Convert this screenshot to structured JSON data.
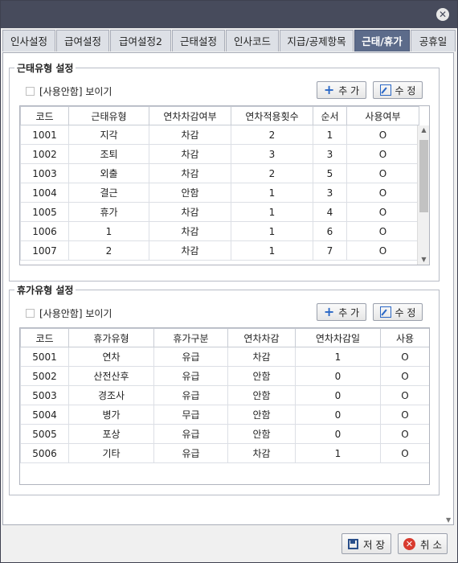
{
  "window": {
    "close_glyph": "✕"
  },
  "tabs": [
    {
      "label": "인사설정"
    },
    {
      "label": "급여설정"
    },
    {
      "label": "급여설정2"
    },
    {
      "label": "근태설정"
    },
    {
      "label": "인사코드"
    },
    {
      "label": "지급/공제항목"
    },
    {
      "label": "근태/휴가"
    },
    {
      "label": "공휴일"
    }
  ],
  "active_tab": "근태/휴가",
  "attendance": {
    "title": "근태유형 설정",
    "show_unused_label": "[사용안함] 보이기",
    "add_label": "추 가",
    "edit_label": "수 정",
    "columns": [
      "코드",
      "근태유형",
      "연차차감여부",
      "연차적용횟수",
      "순서",
      "사용여부"
    ],
    "rows": [
      [
        "1001",
        "지각",
        "차감",
        "2",
        "1",
        "O"
      ],
      [
        "1002",
        "조퇴",
        "차감",
        "3",
        "3",
        "O"
      ],
      [
        "1003",
        "외출",
        "차감",
        "2",
        "5",
        "O"
      ],
      [
        "1004",
        "결근",
        "안함",
        "1",
        "3",
        "O"
      ],
      [
        "1005",
        "휴가",
        "차감",
        "1",
        "4",
        "O"
      ],
      [
        "1006",
        "1",
        "차감",
        "1",
        "6",
        "O"
      ],
      [
        "1007",
        "2",
        "차감",
        "1",
        "7",
        "O"
      ]
    ]
  },
  "leave": {
    "title": "휴가유형 설정",
    "show_unused_label": "[사용안함] 보이기",
    "add_label": "추 가",
    "edit_label": "수 정",
    "columns": [
      "코드",
      "휴가유형",
      "휴가구분",
      "연차차감",
      "연차차감일",
      "사용"
    ],
    "rows": [
      [
        "5001",
        "연차",
        "유급",
        "차감",
        "1",
        "O"
      ],
      [
        "5002",
        "산전산후",
        "유급",
        "안함",
        "0",
        "O"
      ],
      [
        "5003",
        "경조사",
        "유급",
        "안함",
        "0",
        "O"
      ],
      [
        "5004",
        "병가",
        "무급",
        "안함",
        "0",
        "O"
      ],
      [
        "5005",
        "포상",
        "유급",
        "안함",
        "0",
        "O"
      ],
      [
        "5006",
        "기타",
        "유급",
        "차감",
        "1",
        "O"
      ]
    ]
  },
  "footer": {
    "save_label": "저 장",
    "cancel_label": "취 소"
  },
  "icons": {
    "add": "plus-icon",
    "edit": "edit-icon",
    "save": "save-icon",
    "cancel": "cancel-icon"
  }
}
